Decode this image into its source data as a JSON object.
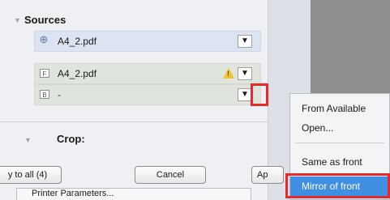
{
  "sources": {
    "title": "Sources",
    "rows": [
      {
        "label": "A4_2.pdf",
        "icon": "link-icon"
      },
      {
        "label": "A4_2.pdf",
        "icon": "F"
      },
      {
        "label": "-",
        "icon": "B"
      }
    ],
    "dropdown_glyph": "▼"
  },
  "crop": {
    "title": "Crop:"
  },
  "buttons": {
    "apply_all": "y to all (4)",
    "cancel": "Cancel",
    "apply": "Ap"
  },
  "subpanel": {
    "label": "Printer Parameters..."
  },
  "menu": {
    "items": [
      "From Available",
      "Open...",
      "Same as front",
      "Mirror of front"
    ],
    "highlighted": "Mirror of front"
  },
  "colors": {
    "highlight": "#3f8fe3",
    "annotation_red": "#e8282a"
  }
}
